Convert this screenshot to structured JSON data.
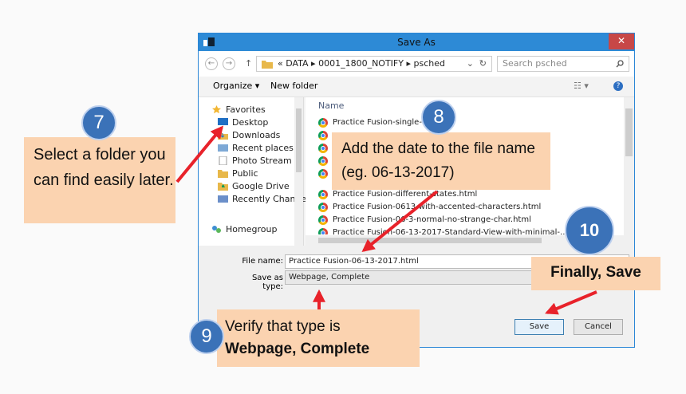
{
  "dialog": {
    "title": "Save As",
    "close_label": "✕",
    "breadcrumb": "« DATA ▸ 0001_1800_NOTIFY ▸ psched",
    "search_placeholder": "Search psched",
    "toolbar": {
      "organize": "Organize ▾",
      "new_folder": "New folder"
    },
    "nav_items": [
      {
        "label": "Favorites",
        "icon": "star-icon"
      },
      {
        "label": "Desktop",
        "icon": "desktop-icon"
      },
      {
        "label": "Downloads",
        "icon": "downloads-icon"
      },
      {
        "label": "Recent places",
        "icon": "recent-places-icon"
      },
      {
        "label": "Photo Stream",
        "icon": "photo-stream-icon"
      },
      {
        "label": "Public",
        "icon": "folder-icon"
      },
      {
        "label": "Google Drive",
        "icon": "google-drive-icon"
      },
      {
        "label": "Recently Changec",
        "icon": "recently-changed-icon"
      },
      {
        "label": "Homegroup",
        "icon": "homegroup-icon"
      }
    ],
    "column_header": "Name",
    "files": [
      "Practice Fusion-single-app",
      "",
      "",
      "",
      "",
      "Practice Fusion-different-states.html",
      "Practice Fusion-0613-with-accented-characters.html",
      "Practice Fusion-06-3-normal-no-strange-char.html",
      "Practice Fusion-06-13-2017-Standard-View-with-minimal-..."
    ],
    "file_name_label": "File name:",
    "file_name_value": "Practice Fusion-06-13-2017.html",
    "save_type_label": "Save as type:",
    "save_type_value": "Webpage, Complete",
    "save_button": "Save",
    "cancel_button": "Cancel"
  },
  "annotations": {
    "step7": {
      "number": "7",
      "text": "Select a folder you can find easily later."
    },
    "step8": {
      "number": "8",
      "text": "Add the date to the file name (eg. 06-13-2017)"
    },
    "step9": {
      "number": "9",
      "line1": "Verify that type is",
      "line2": "Webpage, Complete"
    },
    "step10": {
      "number": "10",
      "text": "Finally, Save"
    }
  },
  "colors": {
    "callout": "#fbd3b0",
    "circle": "#3b72b8",
    "arrow": "#e8222a",
    "title_bar": "#2d8ad6"
  }
}
